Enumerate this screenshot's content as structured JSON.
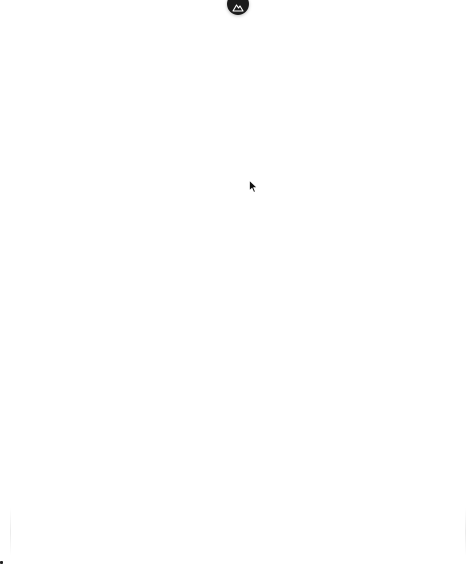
{
  "app": {
    "badge_icon": "mountain-logo-icon",
    "badge_color": "#1b1b1b"
  },
  "canvas": {
    "background_color": "#ffffff"
  },
  "cursor": {
    "icon": "arrow-cursor-icon"
  }
}
